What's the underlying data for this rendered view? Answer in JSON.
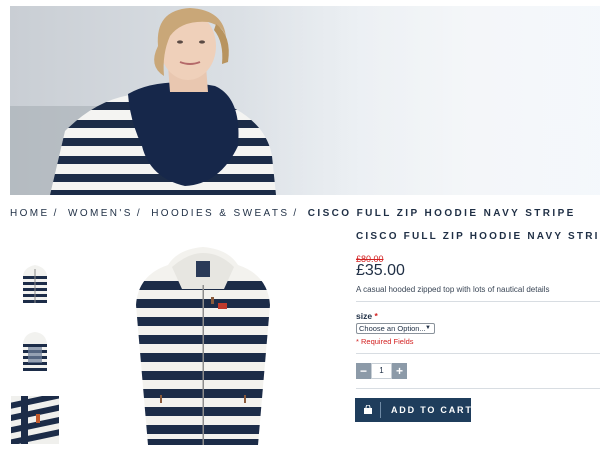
{
  "breadcrumb": {
    "items": [
      "HOME",
      "WOMEN'S",
      "HOODIES & SWEATS"
    ],
    "separator": "/",
    "current": "CISCO FULL ZIP HOODIE NAVY STRIPE"
  },
  "product": {
    "title": "CISCO FULL ZIP HOODIE NAVY STRIPE",
    "old_price": "£80.00",
    "price": "£35.00",
    "description": "A casual hooded zipped top with lots of nautical details"
  },
  "options": {
    "size_label": "size",
    "required_mark": "*",
    "size_select_value": "Choose an Option...",
    "required_note": "* Required Fields"
  },
  "quantity": {
    "minus_label": "−",
    "value": "1",
    "plus_label": "+"
  },
  "cart_button": {
    "label": "ADD TO CART",
    "icon": "shopping-bag-icon"
  },
  "colors": {
    "navy": "#1f3d5c",
    "text": "#1f2f45",
    "sale_red": "#d32222",
    "qty_button": "#8c9aa8"
  }
}
